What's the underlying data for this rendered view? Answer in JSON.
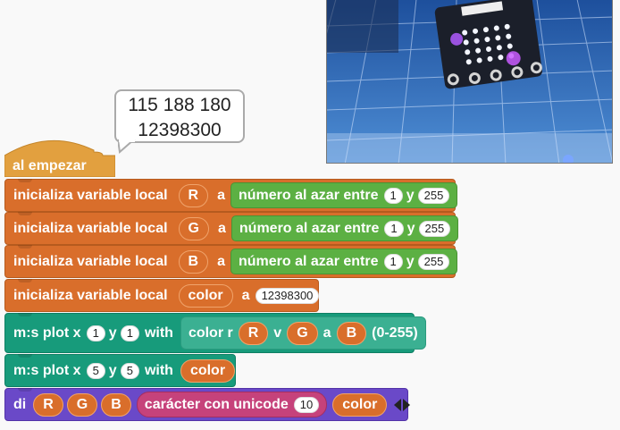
{
  "bubble": {
    "line1": "115 188 180",
    "line2": "12398300"
  },
  "hat": {
    "label": "al empezar"
  },
  "init_rows": [
    {
      "prefix": "inicializa variable local",
      "var": "R",
      "a": "a",
      "rand": "número al azar entre",
      "min": "1",
      "y": "y",
      "max": "255"
    },
    {
      "prefix": "inicializa variable local",
      "var": "G",
      "a": "a",
      "rand": "número al azar entre",
      "min": "1",
      "y": "y",
      "max": "255"
    },
    {
      "prefix": "inicializa variable local",
      "var": "B",
      "a": "a",
      "rand": "número al azar entre",
      "min": "1",
      "y": "y",
      "max": "255"
    }
  ],
  "color_row": {
    "prefix": "inicializa variable local",
    "var": "color",
    "a": "a",
    "value": "12398300"
  },
  "plot1": {
    "prefix": "m:s plot x",
    "x": "1",
    "y_label": "y",
    "y": "1",
    "with": "with",
    "fn_a": "color r",
    "r": "R",
    "v": "v",
    "g": "G",
    "a": "a",
    "b": "B",
    "suffix": "(0-255)"
  },
  "plot2": {
    "prefix": "m:s plot x",
    "x": "5",
    "y_label": "y",
    "y": "5",
    "with": "with",
    "var": "color"
  },
  "say": {
    "prefix": "di",
    "r": "R",
    "g": "G",
    "b": "B",
    "unicode": "carácter con unicode",
    "code": "10",
    "var": "color"
  },
  "colors": {
    "orange": "#d96e2b",
    "green": "#5cb043",
    "teal": "#179b7b",
    "purple": "#6a49c8",
    "pink": "#c6427b",
    "photo_blue": "#3a6fb5"
  }
}
